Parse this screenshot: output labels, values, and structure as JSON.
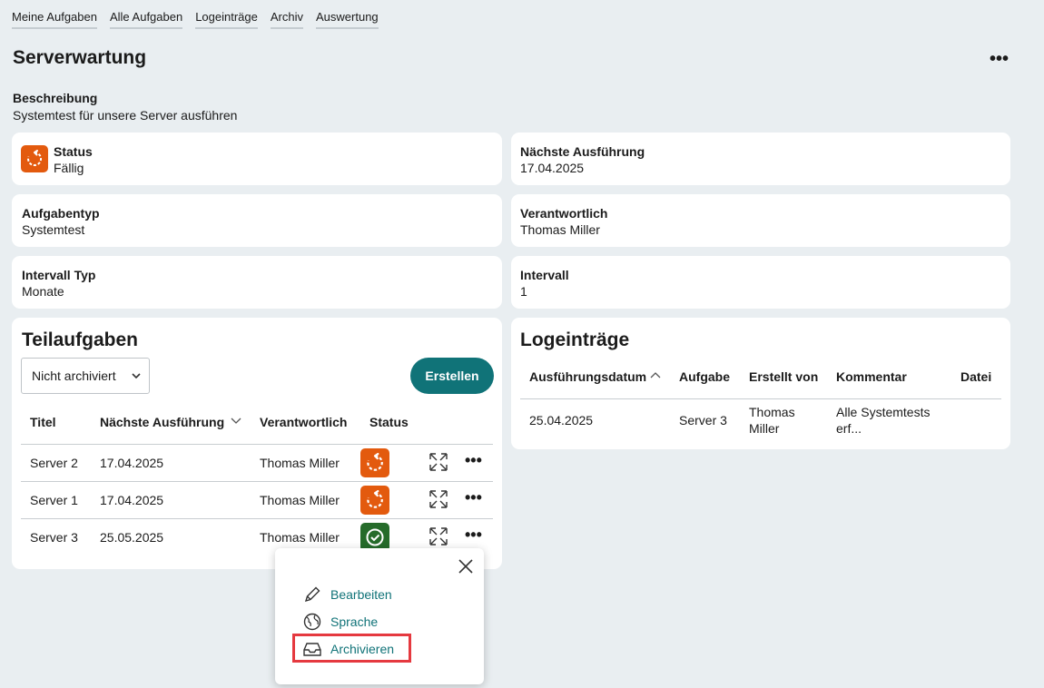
{
  "nav": {
    "items": [
      "Meine Aufgaben",
      "Alle Aufgaben",
      "Logeinträge",
      "Archiv",
      "Auswertung"
    ]
  },
  "page": {
    "title": "Serverwartung",
    "more_label": "•••",
    "description_label": "Beschreibung",
    "description_value": "Systemtest für unsere Server ausführen"
  },
  "details": {
    "status_label": "Status",
    "status_value": "Fällig",
    "next_run_label": "Nächste Ausführung",
    "next_run_value": "17.04.2025",
    "task_type_label": "Aufgabentyp",
    "task_type_value": "Systemtest",
    "responsible_label": "Verantwortlich",
    "responsible_value": "Thomas Miller",
    "interval_type_label": "Intervall Typ",
    "interval_type_value": "Monate",
    "interval_label": "Intervall",
    "interval_value": "1"
  },
  "subtasks": {
    "title": "Teilaufgaben",
    "filter_value": "Nicht archiviert",
    "create_label": "Erstellen",
    "columns": [
      "Titel",
      "Nächste Ausführung",
      "Verantwortlich",
      "Status"
    ],
    "rows": [
      {
        "title": "Server 2",
        "next": "17.04.2025",
        "responsible": "Thomas Miller",
        "status": "due"
      },
      {
        "title": "Server 1",
        "next": "17.04.2025",
        "responsible": "Thomas Miller",
        "status": "due"
      },
      {
        "title": "Server 3",
        "next": "25.05.2025",
        "responsible": "Thomas Miller",
        "status": "done"
      }
    ],
    "row_more_label": "•••"
  },
  "logs": {
    "title": "Logeinträge",
    "columns": [
      "Ausführungsdatum",
      "Aufgabe",
      "Erstellt von",
      "Kommentar",
      "Datei"
    ],
    "rows": [
      {
        "date": "25.04.2025",
        "task": "Server 3",
        "author_line1": "Thomas",
        "author_line2": "Miller",
        "comment_line1": "Alle Systemtests",
        "comment_line2": "erf..."
      }
    ]
  },
  "popup": {
    "items": [
      {
        "label": "Bearbeiten",
        "icon": "pencil-icon"
      },
      {
        "label": "Sprache",
        "icon": "globe-icon"
      },
      {
        "label": "Archivieren",
        "icon": "archive-inbox-icon"
      }
    ]
  },
  "colors": {
    "accent": "#107378",
    "status_due": "#e35a0e",
    "status_done": "#256b2a",
    "highlight": "#e5393f",
    "background": "#e9eef1"
  }
}
